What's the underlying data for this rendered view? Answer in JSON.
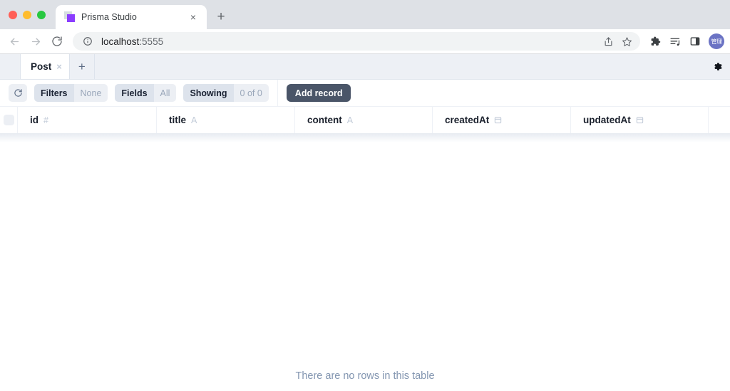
{
  "browser": {
    "traffic_lights": [
      {
        "name": "close",
        "color": "#ff5f57"
      },
      {
        "name": "minimize",
        "color": "#febc2e"
      },
      {
        "name": "maximize",
        "color": "#28c840"
      }
    ],
    "tab": {
      "title": "Prisma Studio",
      "close_label": "×",
      "favicon_name": "prisma-favicon"
    },
    "new_tab_label": "+",
    "nav": {
      "back_label": "←",
      "forward_label": "→",
      "reload_label": "↻"
    },
    "omnibox": {
      "host": "localhost",
      "port": ":5555",
      "info_icon": "info-icon",
      "share_icon": "share-icon",
      "bookmark_icon": "star-icon"
    },
    "toolbar_icons": [
      {
        "name": "extensions-icon"
      },
      {
        "name": "reading-list-icon"
      },
      {
        "name": "side-panel-icon"
      }
    ],
    "avatar": {
      "label": "管理",
      "color": "#6b73c4"
    }
  },
  "studio": {
    "tabs": [
      {
        "label": "Post",
        "close_label": "×",
        "active": true
      }
    ],
    "add_tab_label": "+",
    "settings_icon": "gear-icon",
    "toolbar": {
      "refresh_icon": "refresh-icon",
      "filters_label": "Filters",
      "filters_value": "None",
      "fields_label": "Fields",
      "fields_value": "All",
      "showing_label": "Showing",
      "showing_value": "0 of 0",
      "add_record_label": "Add record"
    },
    "table": {
      "columns": [
        {
          "name": "id",
          "type_icon": "#",
          "type": "number"
        },
        {
          "name": "title",
          "type_icon": "A",
          "type": "string"
        },
        {
          "name": "content",
          "type_icon": "A",
          "type": "string"
        },
        {
          "name": "createdAt",
          "type_icon": "calendar",
          "type": "datetime"
        },
        {
          "name": "updatedAt",
          "type_icon": "calendar",
          "type": "datetime"
        }
      ],
      "rows": [],
      "empty_message": "There are no rows in this table"
    }
  },
  "colors": {
    "accent": "#8b3dff",
    "button_dark": "#4a5568",
    "chrome_bg": "#dee1e6",
    "studio_tabbar": "#edf0f5",
    "empty_text": "#8295b0"
  }
}
